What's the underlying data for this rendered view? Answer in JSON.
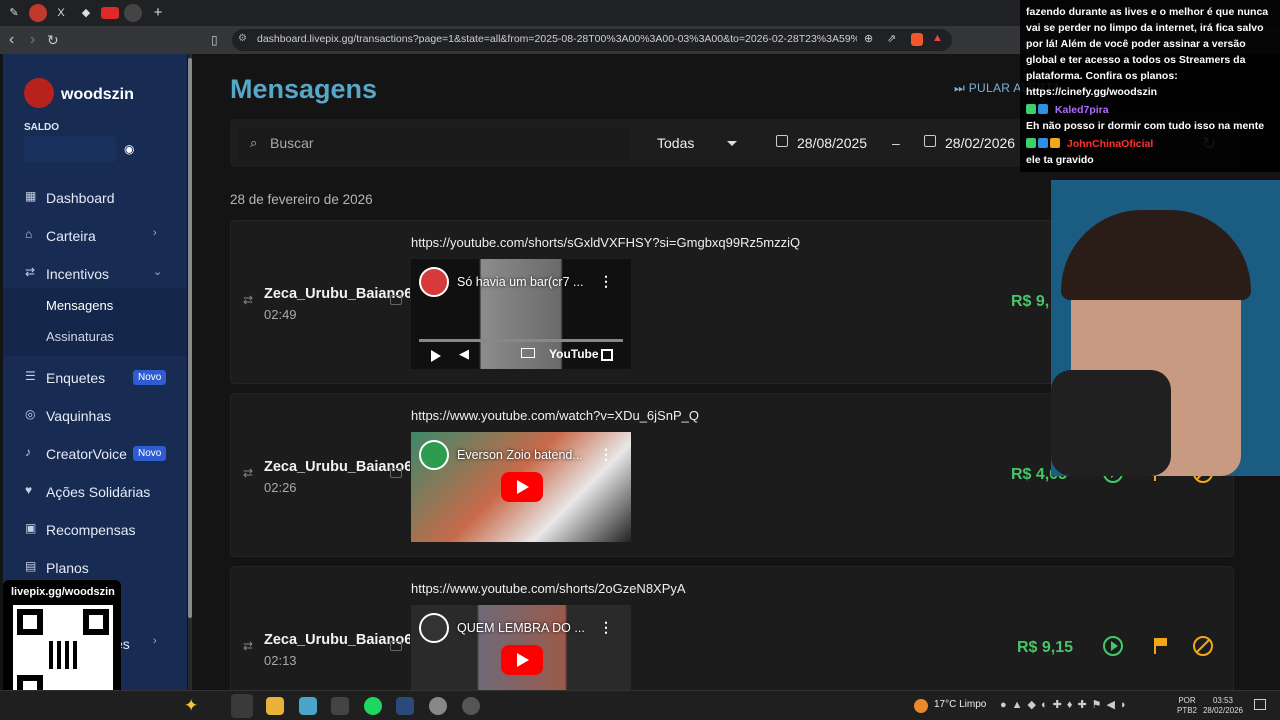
{
  "browser": {
    "url": "dashboard.livepix.gg/transactions?page=1&state=all&from=2025-08-28T00%3A00%3A00-03%3A00&to=2026-02-28T23%3A59%3A59-03%3A..."
  },
  "sidebar": {
    "username": "woodszin",
    "balance_label": "SALDO",
    "items": [
      {
        "label": "Dashboard"
      },
      {
        "label": "Carteira"
      },
      {
        "label": "Incentivos"
      },
      {
        "label": "Mensagens"
      },
      {
        "label": "Assinaturas"
      },
      {
        "label": "Enquetes",
        "badge": "Novo"
      },
      {
        "label": "Vaquinhas"
      },
      {
        "label": "CreatorVoice",
        "badge": "Novo"
      },
      {
        "label": "Ações Solidárias"
      },
      {
        "label": "Recompensas"
      },
      {
        "label": "Planos"
      },
      {
        "label": "es"
      }
    ]
  },
  "main": {
    "title": "Mensagens",
    "skip_alert": "PULAR ALERTA",
    "search_placeholder": "Buscar",
    "state_filter": "Todas",
    "date_from": "28/08/2025",
    "date_sep": "–",
    "date_to": "28/02/2026",
    "date_heading": "28 de fevereiro de 2026",
    "messages": [
      {
        "user": "Zeca_Urubu_Baiano69",
        "time": "02:49",
        "link": "https://youtube.com/shorts/sGxldVXFHSY?si=Gmgbxq99Rz5mzziQ",
        "video_title": "Só havia um bar(cr7 ...",
        "amount": "R$ 9,"
      },
      {
        "user": "Zeca_Urubu_Baiano69",
        "time": "02:26",
        "link": "https://www.youtube.com/watch?v=XDu_6jSnP_Q",
        "video_title": "Everson Zoio batend...",
        "amount": "R$ 4,05"
      },
      {
        "user": "Zeca_Urubu_Baiano69",
        "time": "02:13",
        "link": "https://www.youtube.com/shorts/2oGzeN8XPyA",
        "video_title": "QUEM LEMBRA DO ...",
        "amount": "R$ 9,15"
      }
    ],
    "youtube_logo": "YouTube"
  },
  "chat": {
    "lines": [
      {
        "text": "fazendo durante as lives e o melhor é que nunca vai se perder no limpo da internet, irá fica salvo por lá! Além de você poder assinar a versão global e ter acesso a todos os Streamers da plataforma. Confira os planos: https://cinefy.gg/woodszin"
      },
      {
        "user": "Kaled7pira",
        "color": "#b06cff"
      },
      {
        "text": "Eh não posso ir dormir com tudo isso na mente"
      },
      {
        "user": "JohnChinaOficial",
        "color": "#ff3030"
      },
      {
        "text": "ele ta gravido"
      }
    ]
  },
  "qr": {
    "label": "livepix.gg/woodszin"
  },
  "taskbar": {
    "weather": "17°C  Limpo",
    "lang": "POR\nPTB2",
    "time": "03:53",
    "date": "28/02/2026"
  },
  "colors": {
    "accent": "#56a7c8",
    "sidebar": "#172b53",
    "amount": "#44c767",
    "action": "#f0a818"
  }
}
